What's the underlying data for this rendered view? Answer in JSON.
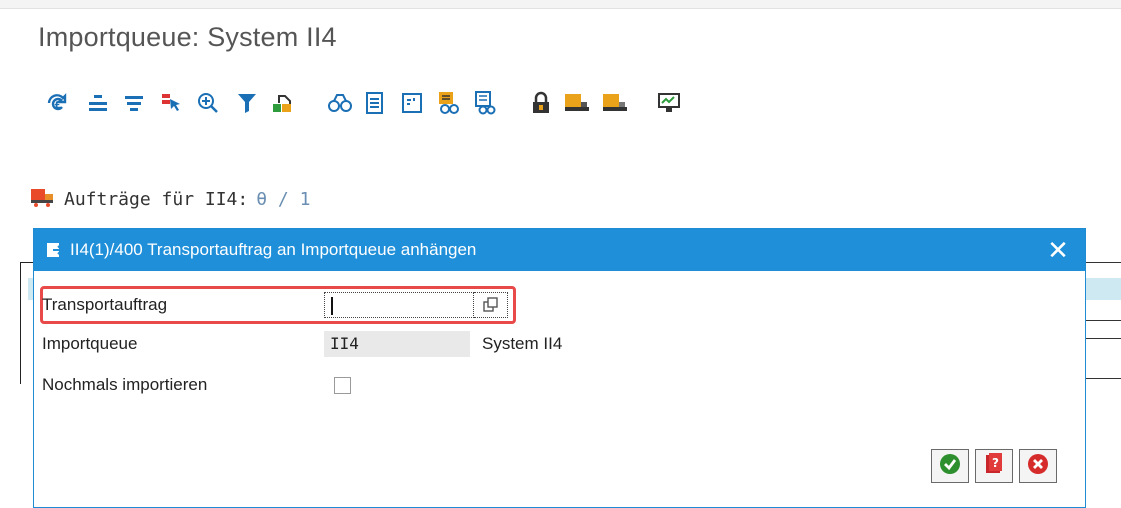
{
  "window": {
    "title": "Importqueue: System II4"
  },
  "toolbar": {
    "icons": [
      "refresh-icon",
      "collapse-icon",
      "expand-icon",
      "select-icon",
      "zoom-icon",
      "filter-icon",
      "import-icon",
      "display-icon",
      "document-icon",
      "layout-icon",
      "request-icon",
      "log-icon",
      "lock-icon",
      "truck-icon",
      "truck-alt-icon",
      "monitor-icon"
    ]
  },
  "queue": {
    "label": "Aufträge für II4:",
    "count": "θ / 1"
  },
  "dialog": {
    "title": "II4(1)/400 Transportauftrag an Importqueue anhängen",
    "close_symbol": "✕",
    "fields": {
      "transport_label": "Transportauftrag",
      "transport_value": "",
      "importqueue_label": "Importqueue",
      "importqueue_value": "II4",
      "importqueue_desc": "System II4",
      "reimport_label": "Nochmals importieren",
      "reimport_checked": false
    },
    "buttons": [
      "confirm-icon",
      "help-icon",
      "cancel-icon"
    ]
  },
  "colors": {
    "dialog_header": "#1f8fd9",
    "highlight": "#e84a4a",
    "row_highlight": "#cfe9f3"
  }
}
